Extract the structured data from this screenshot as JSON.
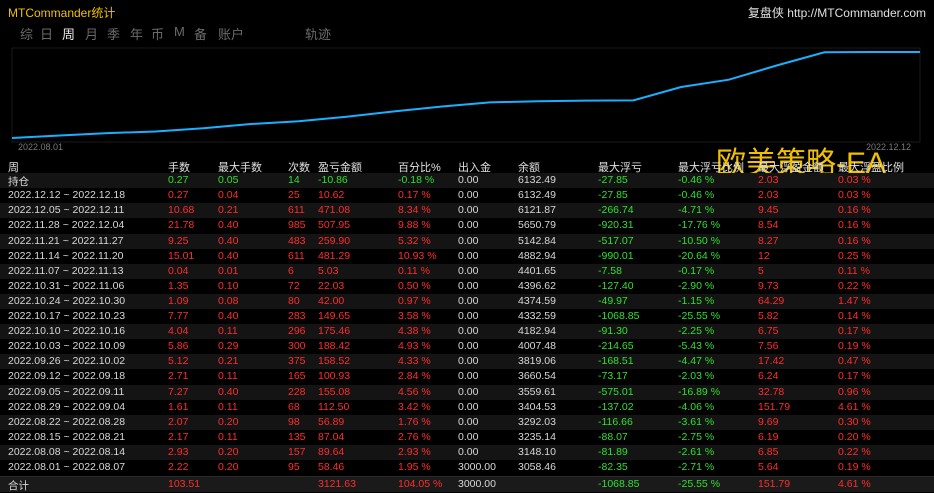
{
  "window": {
    "title": "MTCommander统计",
    "brand": "复盘侠",
    "url": "http://MTCommander.com"
  },
  "tabs": [
    {
      "label": "综",
      "active": false
    },
    {
      "label": "日",
      "active": false
    },
    {
      "label": "周",
      "active": true
    },
    {
      "label": "月",
      "active": false
    },
    {
      "label": "季",
      "active": false
    },
    {
      "label": "年",
      "active": false
    },
    {
      "label": "币",
      "active": false
    },
    {
      "label": "M",
      "active": false
    },
    {
      "label": "备",
      "active": false
    },
    {
      "label": "账户",
      "active": false
    },
    {
      "label": "轨迹",
      "active": false
    }
  ],
  "chart": {
    "strategy_label": "欧美策略-EA",
    "start_date": "2022.08.01",
    "end_date": "2022.12.12",
    "line_color": "#1ab0ff",
    "equity": [
      3058.46,
      3148.1,
      3235.14,
      3292.03,
      3404.53,
      3559.61,
      3660.54,
      3819.06,
      4007.48,
      4182.94,
      4332.59,
      4374.59,
      4396.62,
      4401.65,
      4882.94,
      5142.84,
      5650.79,
      6121.87,
      6132.49,
      6132.49
    ]
  },
  "table": {
    "headers": [
      "周",
      "手数",
      "最大手数",
      "次数",
      "盈亏金额",
      "百分比%",
      "出入金",
      "余额",
      "最大浮亏",
      "最大浮亏比例",
      "最大浮盈金额",
      "最大浮盈比例"
    ],
    "position_row": {
      "label": "持仓",
      "lots": "0.27",
      "max_lots": "0.05",
      "count": "14",
      "pnl": "-10.86",
      "pct": "-0.18 %",
      "deposit": "0.00",
      "balance": "6132.49",
      "max_dd": "-27.85",
      "max_dd_pct": "-0.46 %",
      "max_fp": "2.03",
      "max_fp_pct": "0.03 %"
    },
    "rows": [
      {
        "week": "2022.12.12 ~ 2022.12.18",
        "lots": "0.27",
        "max_lots": "0.04",
        "count": "25",
        "pnl": "10.62",
        "pct": "0.17 %",
        "deposit": "0.00",
        "balance": "6132.49",
        "max_dd": "-27.85",
        "max_dd_pct": "-0.46 %",
        "max_fp": "2.03",
        "max_fp_pct": "0.03 %"
      },
      {
        "week": "2022.12.05 ~ 2022.12.11",
        "lots": "10.68",
        "max_lots": "0.21",
        "count": "611",
        "pnl": "471.08",
        "pct": "8.34 %",
        "deposit": "0.00",
        "balance": "6121.87",
        "max_dd": "-266.74",
        "max_dd_pct": "-4.71 %",
        "max_fp": "9.45",
        "max_fp_pct": "0.16 %"
      },
      {
        "week": "2022.11.28 ~ 2022.12.04",
        "lots": "21.78",
        "max_lots": "0.40",
        "count": "985",
        "pnl": "507.95",
        "pct": "9.88 %",
        "deposit": "0.00",
        "balance": "5650.79",
        "max_dd": "-920.31",
        "max_dd_pct": "-17.76 %",
        "max_fp": "8.54",
        "max_fp_pct": "0.16 %"
      },
      {
        "week": "2022.11.21 ~ 2022.11.27",
        "lots": "9.25",
        "max_lots": "0.40",
        "count": "483",
        "pnl": "259.90",
        "pct": "5.32 %",
        "deposit": "0.00",
        "balance": "5142.84",
        "max_dd": "-517.07",
        "max_dd_pct": "-10.50 %",
        "max_fp": "8.27",
        "max_fp_pct": "0.16 %"
      },
      {
        "week": "2022.11.14 ~ 2022.11.20",
        "lots": "15.01",
        "max_lots": "0.40",
        "count": "611",
        "pnl": "481.29",
        "pct": "10.93 %",
        "deposit": "0.00",
        "balance": "4882.94",
        "max_dd": "-990.01",
        "max_dd_pct": "-20.64 %",
        "max_fp": "12",
        "max_fp_pct": "0.25 %"
      },
      {
        "week": "2022.11.07 ~ 2022.11.13",
        "lots": "0.04",
        "max_lots": "0.01",
        "count": "6",
        "pnl": "5.03",
        "pct": "0.11 %",
        "deposit": "0.00",
        "balance": "4401.65",
        "max_dd": "-7.58",
        "max_dd_pct": "-0.17 %",
        "max_fp": "5",
        "max_fp_pct": "0.11 %"
      },
      {
        "week": "2022.10.31 ~ 2022.11.06",
        "lots": "1.35",
        "max_lots": "0.10",
        "count": "72",
        "pnl": "22.03",
        "pct": "0.50 %",
        "deposit": "0.00",
        "balance": "4396.62",
        "max_dd": "-127.40",
        "max_dd_pct": "-2.90 %",
        "max_fp": "9.73",
        "max_fp_pct": "0.22 %"
      },
      {
        "week": "2022.10.24 ~ 2022.10.30",
        "lots": "1.09",
        "max_lots": "0.08",
        "count": "80",
        "pnl": "42.00",
        "pct": "0.97 %",
        "deposit": "0.00",
        "balance": "4374.59",
        "max_dd": "-49.97",
        "max_dd_pct": "-1.15 %",
        "max_fp": "64.29",
        "max_fp_pct": "1.47 %"
      },
      {
        "week": "2022.10.17 ~ 2022.10.23",
        "lots": "7.77",
        "max_lots": "0.40",
        "count": "283",
        "pnl": "149.65",
        "pct": "3.58 %",
        "deposit": "0.00",
        "balance": "4332.59",
        "max_dd": "-1068.85",
        "max_dd_pct": "-25.55 %",
        "max_fp": "5.82",
        "max_fp_pct": "0.14 %"
      },
      {
        "week": "2022.10.10 ~ 2022.10.16",
        "lots": "4.04",
        "max_lots": "0.11",
        "count": "296",
        "pnl": "175.46",
        "pct": "4.38 %",
        "deposit": "0.00",
        "balance": "4182.94",
        "max_dd": "-91.30",
        "max_dd_pct": "-2.25 %",
        "max_fp": "6.75",
        "max_fp_pct": "0.17 %"
      },
      {
        "week": "2022.10.03 ~ 2022.10.09",
        "lots": "5.86",
        "max_lots": "0.29",
        "count": "300",
        "pnl": "188.42",
        "pct": "4.93 %",
        "deposit": "0.00",
        "balance": "4007.48",
        "max_dd": "-214.65",
        "max_dd_pct": "-5.43 %",
        "max_fp": "7.56",
        "max_fp_pct": "0.19 %"
      },
      {
        "week": "2022.09.26 ~ 2022.10.02",
        "lots": "5.12",
        "max_lots": "0.21",
        "count": "375",
        "pnl": "158.52",
        "pct": "4.33 %",
        "deposit": "0.00",
        "balance": "3819.06",
        "max_dd": "-168.51",
        "max_dd_pct": "-4.47 %",
        "max_fp": "17.42",
        "max_fp_pct": "0.47 %"
      },
      {
        "week": "2022.09.12 ~ 2022.09.18",
        "lots": "2.71",
        "max_lots": "0.11",
        "count": "165",
        "pnl": "100.93",
        "pct": "2.84 %",
        "deposit": "0.00",
        "balance": "3660.54",
        "max_dd": "-73.17",
        "max_dd_pct": "-2.03 %",
        "max_fp": "6.24",
        "max_fp_pct": "0.17 %"
      },
      {
        "week": "2022.09.05 ~ 2022.09.11",
        "lots": "7.27",
        "max_lots": "0.40",
        "count": "228",
        "pnl": "155.08",
        "pct": "4.56 %",
        "deposit": "0.00",
        "balance": "3559.61",
        "max_dd": "-575.01",
        "max_dd_pct": "-16.89 %",
        "max_fp": "32.78",
        "max_fp_pct": "0.96 %"
      },
      {
        "week": "2022.08.29 ~ 2022.09.04",
        "lots": "1.61",
        "max_lots": "0.11",
        "count": "68",
        "pnl": "112.50",
        "pct": "3.42 %",
        "deposit": "0.00",
        "balance": "3404.53",
        "max_dd": "-137.02",
        "max_dd_pct": "-4.06 %",
        "max_fp": "151.79",
        "max_fp_pct": "4.61 %"
      },
      {
        "week": "2022.08.22 ~ 2022.08.28",
        "lots": "2.07",
        "max_lots": "0.20",
        "count": "98",
        "pnl": "56.89",
        "pct": "1.76 %",
        "deposit": "0.00",
        "balance": "3292.03",
        "max_dd": "-116.66",
        "max_dd_pct": "-3.61 %",
        "max_fp": "9.69",
        "max_fp_pct": "0.30 %"
      },
      {
        "week": "2022.08.15 ~ 2022.08.21",
        "lots": "2.17",
        "max_lots": "0.11",
        "count": "135",
        "pnl": "87.04",
        "pct": "2.76 %",
        "deposit": "0.00",
        "balance": "3235.14",
        "max_dd": "-88.07",
        "max_dd_pct": "-2.75 %",
        "max_fp": "6.19",
        "max_fp_pct": "0.20 %"
      },
      {
        "week": "2022.08.08 ~ 2022.08.14",
        "lots": "2.93",
        "max_lots": "0.20",
        "count": "157",
        "pnl": "89.64",
        "pct": "2.93 %",
        "deposit": "0.00",
        "balance": "3148.10",
        "max_dd": "-81.89",
        "max_dd_pct": "-2.61 %",
        "max_fp": "6.85",
        "max_fp_pct": "0.22 %"
      },
      {
        "week": "2022.08.01 ~ 2022.08.07",
        "lots": "2.22",
        "max_lots": "0.20",
        "count": "95",
        "pnl": "58.46",
        "pct": "1.95 %",
        "deposit": "3000.00",
        "balance": "3058.46",
        "max_dd": "-82.35",
        "max_dd_pct": "-2.71 %",
        "max_fp": "5.64",
        "max_fp_pct": "0.19 %"
      }
    ],
    "total_row": {
      "label": "合计",
      "lots": "103.51",
      "max_lots": "",
      "count": "",
      "pnl": "3121.63",
      "pct": "104.05 %",
      "deposit": "3000.00",
      "balance": "",
      "max_dd": "-1068.85",
      "max_dd_pct": "-25.55 %",
      "max_fp": "151.79",
      "max_fp_pct": "4.61 %"
    }
  },
  "colors": {
    "positive": "#ff2d2d",
    "negative": "#2fe02f",
    "neutral": "#d8d8d8",
    "accent": "#f0c000"
  }
}
